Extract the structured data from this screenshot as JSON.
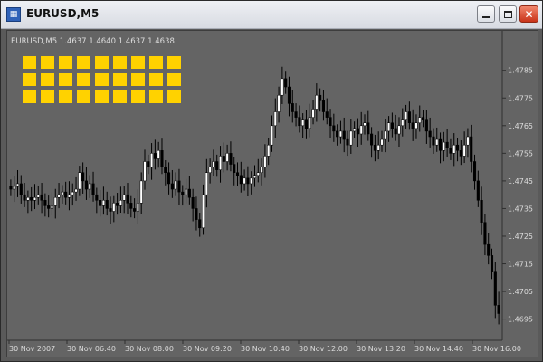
{
  "window": {
    "title": "EURUSD,M5",
    "icon": "metatrader-chart-icon",
    "icon_glyph": "▦",
    "buttons": {
      "minimize_icon": "minimize-icon",
      "maximize_icon": "maximize-icon",
      "close_icon": "close-icon",
      "close_glyph": "✕"
    }
  },
  "chart_header": "EURUSD,M5  1.4637 1.4640 1.4637 1.4638",
  "colors": {
    "background": "#646464",
    "border": "#3d3d3d",
    "bull_candle_body": "#ffffff",
    "bear_candle_body": "#000000",
    "candle_wick": "#000000",
    "axis_text": "#dcdcdc",
    "indicator_squares": "#ffd200"
  },
  "indicator_grid": {
    "rows": 3,
    "cols": 9
  },
  "chart_data": {
    "type": "candlestick",
    "symbol": "EURUSD",
    "timeframe": "M5",
    "ylim": [
      1.4688,
      1.4798
    ],
    "y_ticks": [
      "1.4785",
      "1.4775",
      "1.4765",
      "1.4755",
      "1.4745",
      "1.4735",
      "1.4725",
      "1.4715",
      "1.4705",
      "1.4695"
    ],
    "x_ticks": [
      "30 Nov 2007",
      "30 Nov 06:40",
      "30 Nov 08:00",
      "30 Nov 09:20",
      "30 Nov 10:40",
      "30 Nov 12:00",
      "30 Nov 13:20",
      "30 Nov 14:40",
      "30 Nov 16:00"
    ],
    "close_series": [
      1.4742,
      1.4743,
      1.4744,
      1.474,
      1.4738,
      1.4739,
      1.4738,
      1.4739,
      1.474,
      1.4738,
      1.4736,
      1.4735,
      1.4736,
      1.4739,
      1.474,
      1.4741,
      1.4739,
      1.474,
      1.4741,
      1.4742,
      1.4748,
      1.4745,
      1.4742,
      1.4744,
      1.474,
      1.4738,
      1.4736,
      1.4738,
      1.4735,
      1.4734,
      1.4737,
      1.4736,
      1.4738,
      1.474,
      1.4737,
      1.4735,
      1.4734,
      1.4737,
      1.4745,
      1.4752,
      1.475,
      1.4755,
      1.4753,
      1.4756,
      1.475,
      1.4748,
      1.4744,
      1.4742,
      1.4745,
      1.4741,
      1.474,
      1.4742,
      1.4739,
      1.4735,
      1.4731,
      1.4728,
      1.474,
      1.4748,
      1.475,
      1.4752,
      1.4749,
      1.4754,
      1.4752,
      1.4755,
      1.4751,
      1.4748,
      1.4747,
      1.4744,
      1.4746,
      1.4744,
      1.4746,
      1.4747,
      1.4748,
      1.475,
      1.4754,
      1.4758,
      1.4765,
      1.477,
      1.4776,
      1.4782,
      1.4779,
      1.4773,
      1.477,
      1.4768,
      1.4765,
      1.4767,
      1.4764,
      1.4768,
      1.4771,
      1.4776,
      1.4774,
      1.477,
      1.4768,
      1.4765,
      1.4763,
      1.4761,
      1.4763,
      1.476,
      1.4758,
      1.4763,
      1.4764,
      1.4762,
      1.4765,
      1.4766,
      1.4762,
      1.4758,
      1.4756,
      1.4758,
      1.476,
      1.4763,
      1.4766,
      1.4764,
      1.4762,
      1.4765,
      1.4767,
      1.477,
      1.4766,
      1.4764,
      1.4766,
      1.4768,
      1.4767,
      1.4763,
      1.4761,
      1.4758,
      1.476,
      1.4756,
      1.4759,
      1.4757,
      1.4755,
      1.4758,
      1.4756,
      1.4754,
      1.4758,
      1.4761,
      1.4752,
      1.4745,
      1.4738,
      1.473,
      1.4722,
      1.4718,
      1.4712,
      1.47,
      1.4697
    ]
  }
}
